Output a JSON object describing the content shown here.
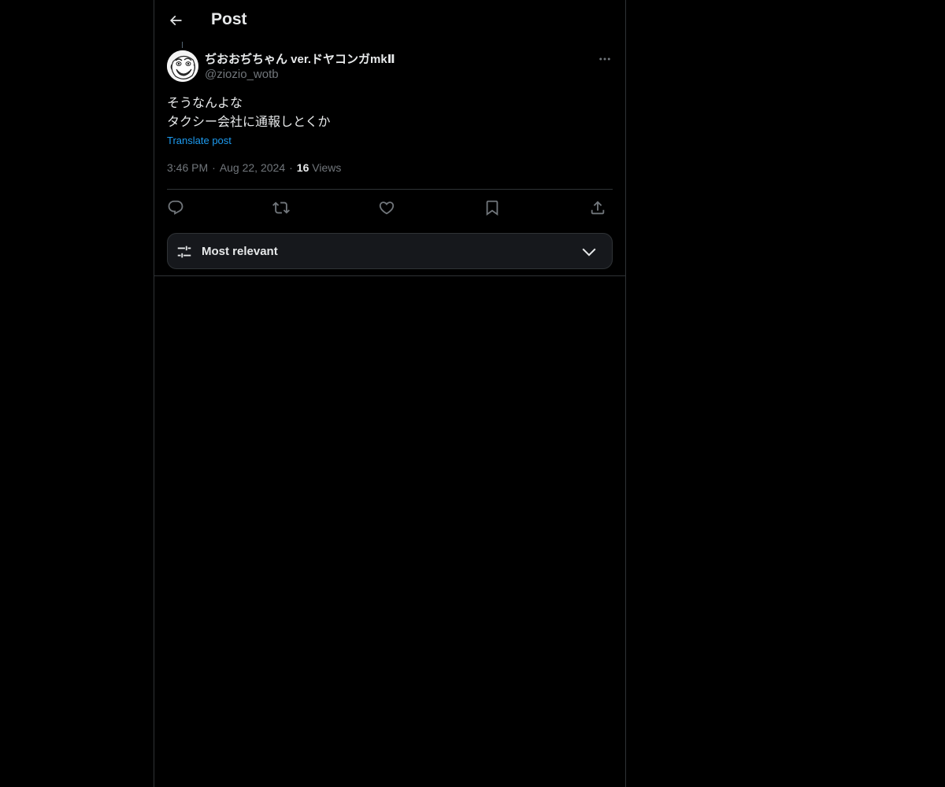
{
  "header": {
    "title": "Post",
    "back_icon": "arrow-left-icon"
  },
  "post": {
    "author": {
      "display_name": "ぢおおぢちゃん ver.ドヤコンガmkⅡ",
      "handle": "@ziozio_wotb"
    },
    "text_lines": [
      "そうなんよな",
      "タクシー会社に通報しとくか"
    ],
    "translate_label": "Translate post",
    "time": "3:46 PM",
    "date": "Aug 22, 2024",
    "separator": "·",
    "views_count": "16",
    "views_label": "Views"
  },
  "actions": {
    "reply_icon": "reply-icon",
    "repost_icon": "repost-icon",
    "like_icon": "heart-icon",
    "bookmark_icon": "bookmark-icon",
    "share_icon": "share-icon"
  },
  "sort": {
    "label": "Most relevant"
  },
  "colors": {
    "background": "#000000",
    "text": "#e7e9ea",
    "muted": "#71767b",
    "link": "#1d9bf0",
    "border": "#2f3336",
    "sort_bg": "#16181c"
  }
}
